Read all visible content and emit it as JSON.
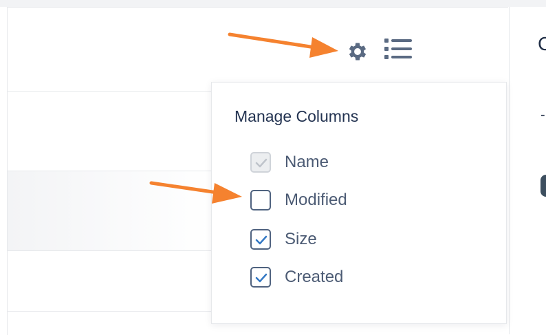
{
  "toolbar": {
    "settings_icon": "gear-icon",
    "view_icon": "list-icon"
  },
  "manage_columns": {
    "title": "Manage Columns",
    "options": [
      {
        "label": "Name",
        "checked": true,
        "disabled": true
      },
      {
        "label": "Modified",
        "checked": false,
        "disabled": false
      },
      {
        "label": "Size",
        "checked": true,
        "disabled": false
      },
      {
        "label": "Created",
        "checked": true,
        "disabled": false
      }
    ]
  },
  "colors": {
    "annotation_arrow": "#f5822f",
    "icon": "#5a6a82",
    "title_text": "#233351",
    "option_text": "#4c5b74",
    "checkbox_border": "#4f627f",
    "check_mark": "#3579c4"
  }
}
